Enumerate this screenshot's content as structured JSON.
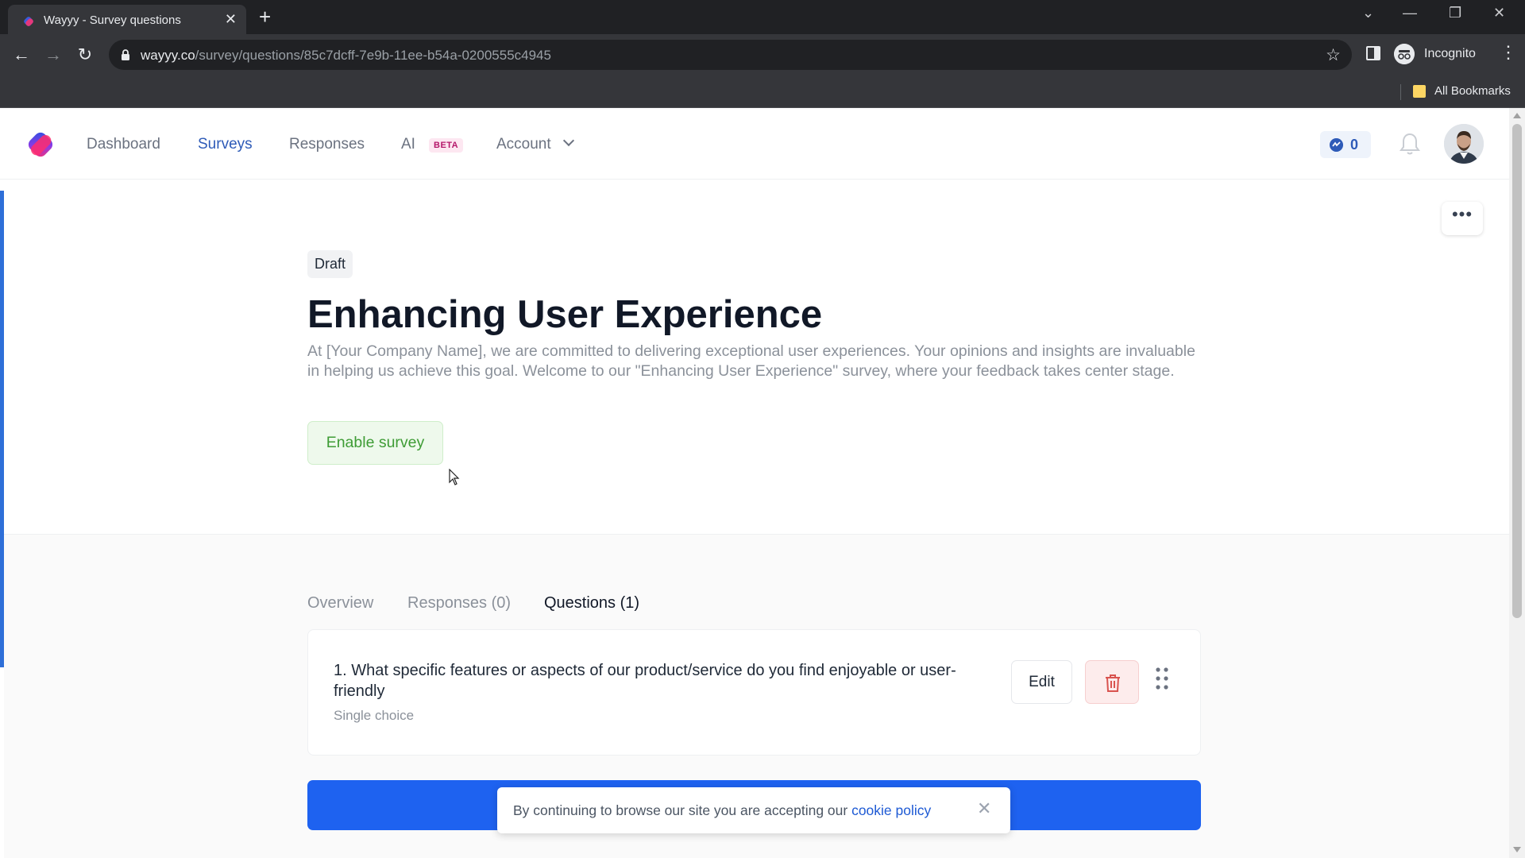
{
  "browser": {
    "tab_title": "Wayyy - Survey questions",
    "url_host": "wayyy.co",
    "url_path": "/survey/questions/85c7dcff-7e9b-11ee-b54a-0200555c4945",
    "profile_label": "Incognito",
    "bookmarks_label": "All Bookmarks"
  },
  "header": {
    "nav": [
      {
        "label": "Dashboard",
        "active": false
      },
      {
        "label": "Surveys",
        "active": true
      },
      {
        "label": "Responses",
        "active": false
      },
      {
        "label": "AI",
        "active": false
      },
      {
        "label": "Account",
        "active": false
      }
    ],
    "beta_badge": "BETA",
    "credits": "0"
  },
  "survey": {
    "status": "Draft",
    "title": "Enhancing User Experience",
    "description": "At [Your Company Name], we are committed to delivering exceptional user experiences. Your opinions and insights are invaluable in helping us achieve this goal. Welcome to our \"Enhancing User Experience\" survey, where your feedback takes center stage.",
    "enable_label": "Enable survey",
    "more_label": "•••"
  },
  "tabs": [
    {
      "label": "Overview",
      "active": false
    },
    {
      "label": "Responses (0)",
      "active": false
    },
    {
      "label": "Questions (1)",
      "active": true
    }
  ],
  "questions": [
    {
      "text": "1. What specific features or aspects of our product/service do you find enjoyable or user-friendly",
      "type": "Single choice",
      "edit_label": "Edit"
    }
  ],
  "cookie": {
    "text": "By continuing to browse our site you are accepting our ",
    "link": "cookie policy",
    "close": "✕"
  },
  "colors": {
    "accent": "#2e5bb8",
    "primary_button": "#1e62f0",
    "enable_green": "#3e9c35",
    "delete_red": "#d9534f"
  }
}
